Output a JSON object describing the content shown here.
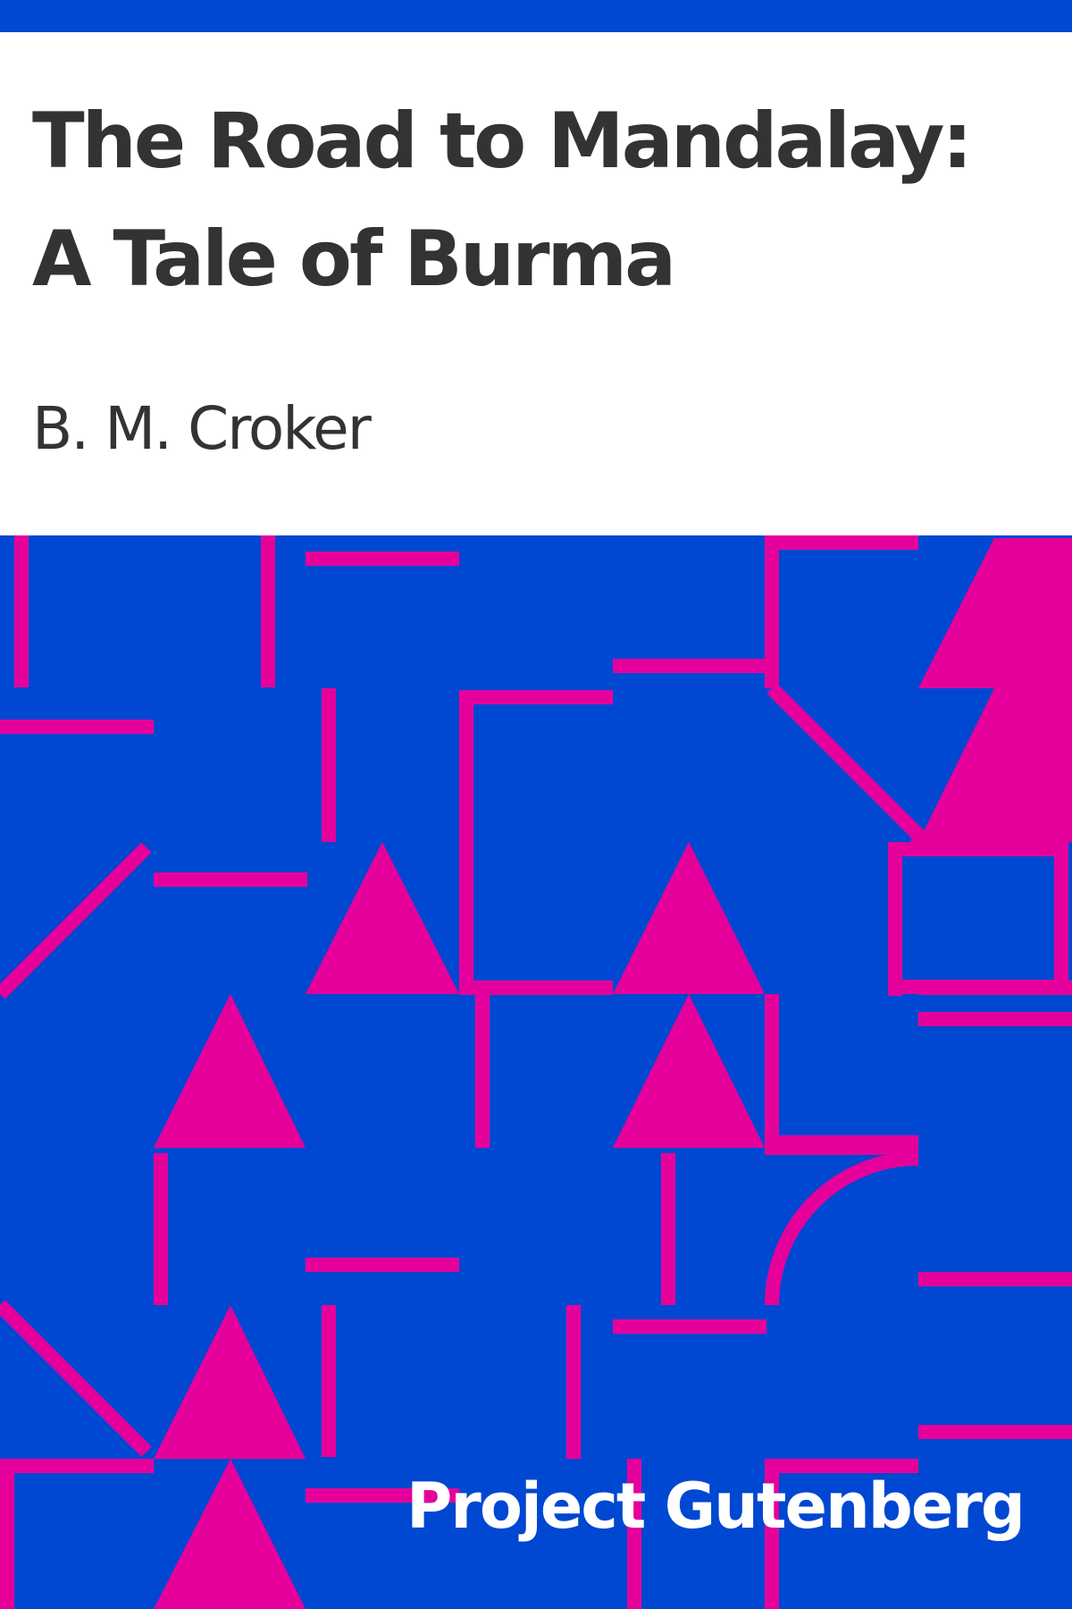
{
  "book": {
    "title": "The Road to Mandalay: A Tale of Burma",
    "author": "B. M. Croker",
    "publisher": "Project Gutenberg"
  },
  "colors": {
    "background_blue": "#0047d1",
    "pattern_magenta": "#e6009b",
    "title_text": "#333333",
    "publisher_text": "#ffffff"
  }
}
